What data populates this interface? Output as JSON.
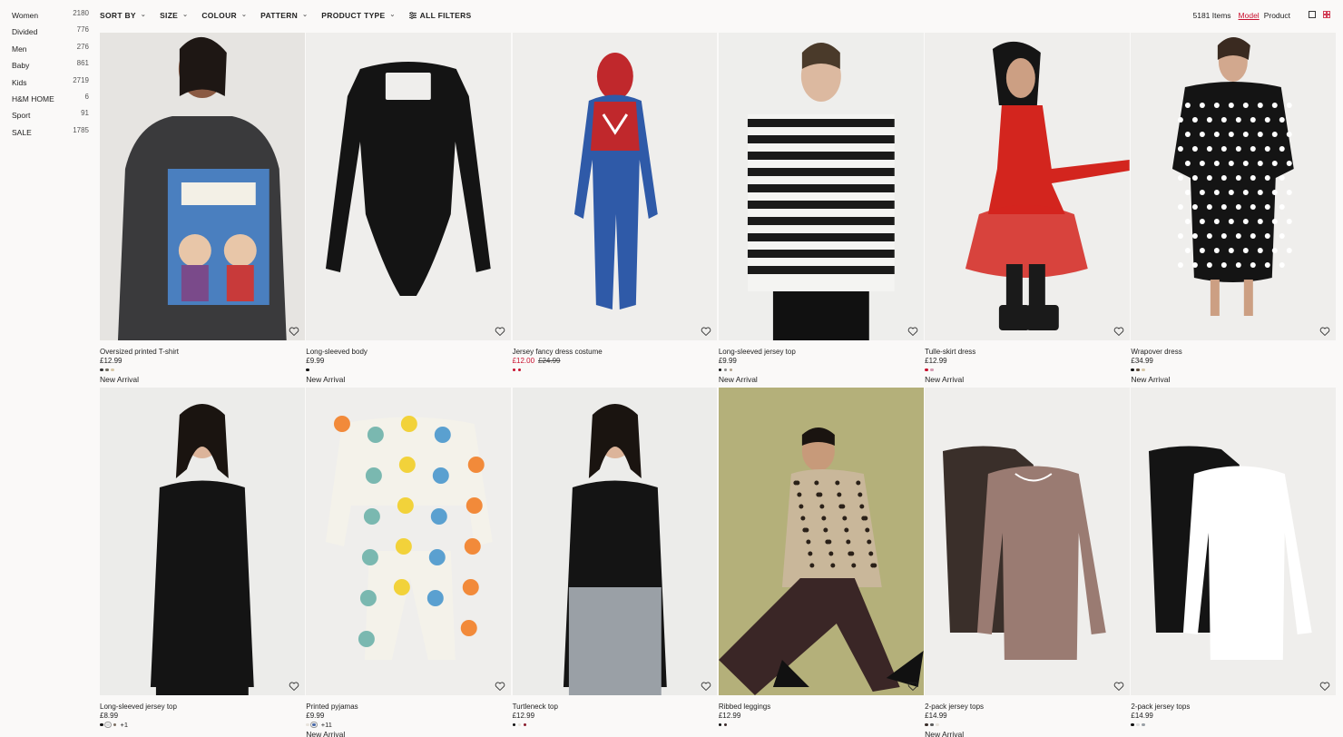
{
  "sidebar": {
    "items": [
      {
        "label": "Women",
        "count": "2180"
      },
      {
        "label": "Divided",
        "count": "776"
      },
      {
        "label": "Men",
        "count": "276"
      },
      {
        "label": "Baby",
        "count": "861"
      },
      {
        "label": "Kids",
        "count": "2719"
      },
      {
        "label": "H&M HOME",
        "count": "6"
      },
      {
        "label": "Sport",
        "count": "91"
      },
      {
        "label": "SALE",
        "count": "1785"
      }
    ]
  },
  "filters": {
    "sort_by": "SORT BY",
    "size": "SIZE",
    "colour": "COLOUR",
    "pattern": "PATTERN",
    "product_type": "PRODUCT TYPE",
    "all_filters": "ALL FILTERS"
  },
  "toolbar": {
    "items_count": "5181 Items",
    "model": "Model",
    "product": "Product"
  },
  "colors": {
    "accent": "#c8102e",
    "text": "#222222",
    "background": "#faf9f8"
  },
  "products": [
    {
      "name": "Oversized printed T-shirt",
      "price": "£12.99",
      "swatches": [
        "#333333",
        "#6d6a5e",
        "#d8c8a8"
      ],
      "badge": "New Arrival",
      "image": {
        "bg": "#e6e4e1",
        "subject": "#3a3a3c",
        "accent": "#4a7fbf",
        "shape": "tee"
      }
    },
    {
      "name": "Long-sleeved body",
      "price": "£9.99",
      "swatches": [
        "#111111"
      ],
      "badge": "New Arrival",
      "image": {
        "bg": "#efeeec",
        "subject": "#141414",
        "accent": "#141414",
        "shape": "body"
      }
    },
    {
      "name": "Jersey fancy dress costume",
      "sale_price": "£12.00",
      "old_price": "£24.99",
      "swatches": [
        "#c8102e",
        "#c8102e"
      ],
      "image": {
        "bg": "#efeeec",
        "subject": "#2f5aa8",
        "accent": "#c0282c",
        "shape": "costume"
      }
    },
    {
      "name": "Long-sleeved jersey top",
      "price": "£9.99",
      "swatches": [
        "#111111",
        "#888888",
        "#b0a08a"
      ],
      "badge": "New Arrival",
      "image": {
        "bg": "#eeeeec",
        "subject": "#1a1a1a",
        "accent": "#f4f4f2",
        "shape": "stripe"
      }
    },
    {
      "name": "Tulle-skirt dress",
      "price": "£12.99",
      "swatches": [
        "#c8102e",
        "#d49ab0"
      ],
      "badge": "New Arrival",
      "image": {
        "bg": "#efeeec",
        "subject": "#d3251e",
        "accent": "#1a1a1a",
        "shape": "dress"
      }
    },
    {
      "name": "Wrapover dress",
      "price": "£34.99",
      "swatches": [
        "#111111",
        "#5a4a3a",
        "#d8c8a8"
      ],
      "badge": "New Arrival",
      "image": {
        "bg": "#efeeec",
        "subject": "#141414",
        "accent": "#ffffff",
        "shape": "dots"
      }
    },
    {
      "name": "Long-sleeved jersey top",
      "price": "£8.99",
      "swatches": [
        "#111111",
        "#dddddd",
        "#7a6d60"
      ],
      "more": "+1",
      "image": {
        "bg": "#ececea",
        "subject": "#141414",
        "accent": "#141414",
        "shape": "model"
      }
    },
    {
      "name": "Printed pyjamas",
      "price": "£9.99",
      "swatches": [
        "#e8e4dc",
        "#4a6aa8"
      ],
      "more": "+11",
      "badge": "New Arrival",
      "image": {
        "bg": "#efeeec",
        "subject": "#f4f2ea",
        "accent": "#f28a3a",
        "shape": "pyjama"
      }
    },
    {
      "name": "Turtleneck top",
      "price": "£12.99",
      "swatches": [
        "#111111",
        "#e8e4dc",
        "#8a1e2e"
      ],
      "image": {
        "bg": "#ececea",
        "subject": "#141414",
        "accent": "#9aa0a6",
        "shape": "model"
      }
    },
    {
      "name": "Ribbed leggings",
      "price": "£12.99",
      "swatches": [
        "#111111",
        "#3a2a2a"
      ],
      "image": {
        "bg": "#b4b07a",
        "subject": "#3a2626",
        "accent": "#c9b79a",
        "shape": "leopard"
      }
    },
    {
      "name": "2-pack jersey tops",
      "price": "£14.99",
      "swatches": [
        "#3a2e2a",
        "#5a5a5a",
        "#e8e4dc"
      ],
      "badge": "New Arrival",
      "image": {
        "bg": "#efeeec",
        "subject": "#3a2f2a",
        "accent": "#9a7b72",
        "shape": "twopack"
      }
    },
    {
      "name": "2-pack jersey tops",
      "price": "£14.99",
      "swatches": [
        "#111111",
        "#dddddd",
        "#9aa0a6"
      ],
      "image": {
        "bg": "#efeeec",
        "subject": "#141414",
        "accent": "#ffffff",
        "shape": "twopack"
      }
    }
  ]
}
